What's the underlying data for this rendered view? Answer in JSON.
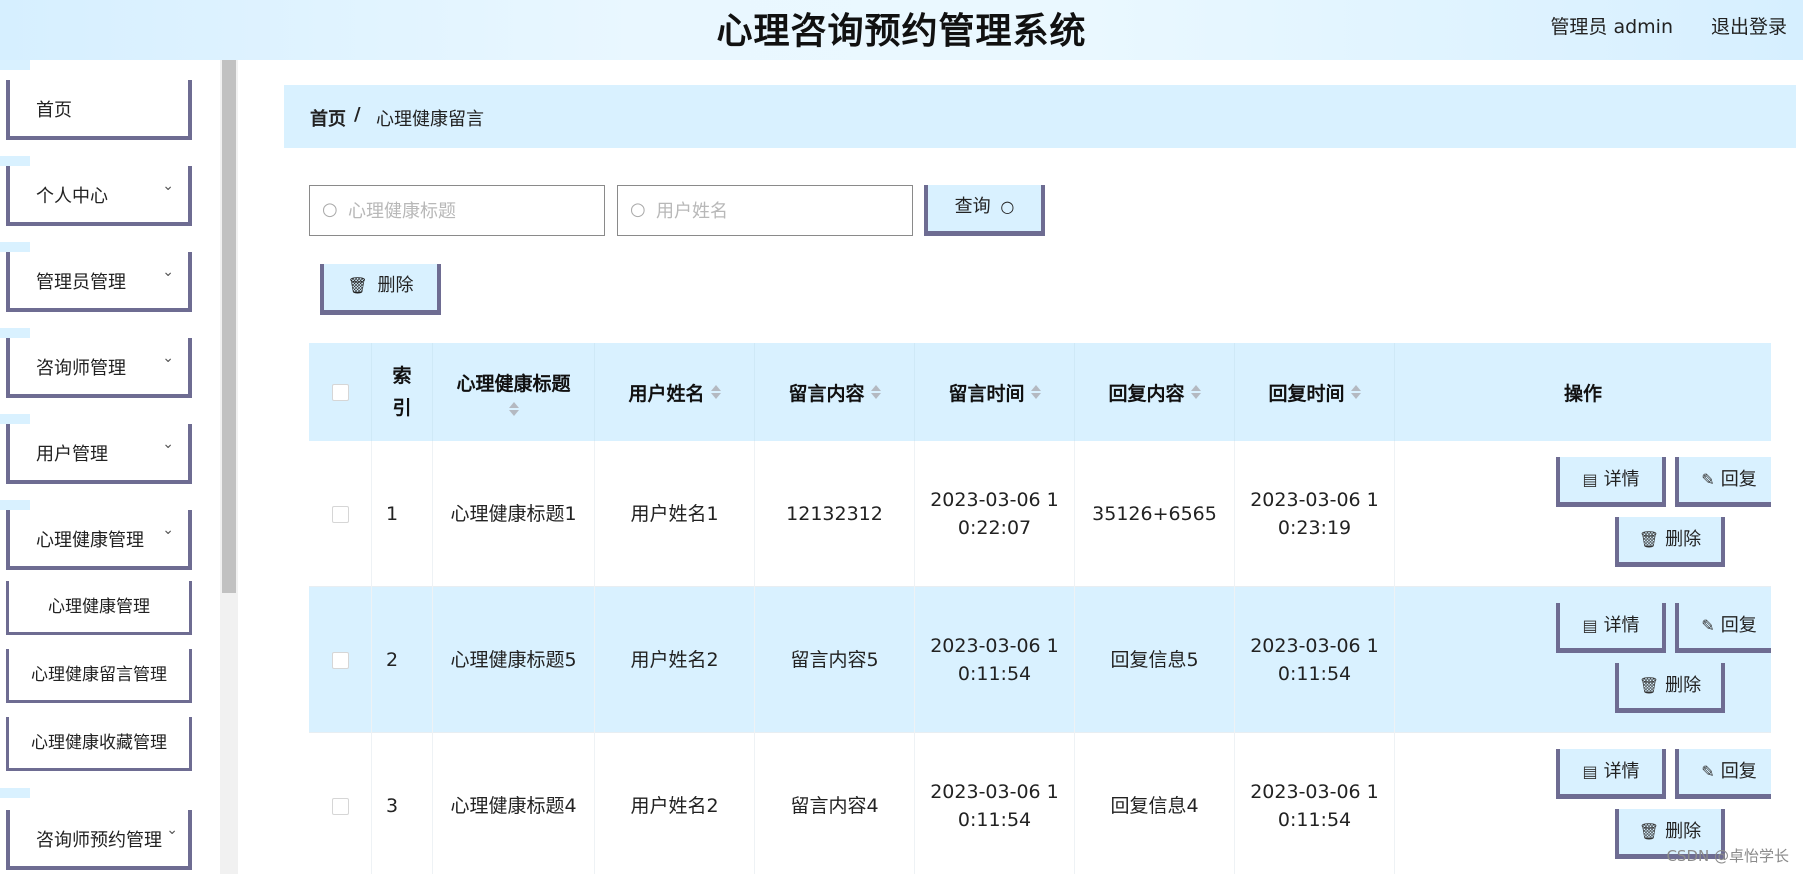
{
  "header": {
    "title": "心理咨询预约管理系统",
    "user": "管理员 admin",
    "logout": "退出登录"
  },
  "sidebar": {
    "items": [
      {
        "label": "首页",
        "chevron": ""
      },
      {
        "label": "个人中心",
        "chevron": "⌄"
      },
      {
        "label": "管理员管理",
        "chevron": "⌄"
      },
      {
        "label": "咨询师管理",
        "chevron": "⌄"
      },
      {
        "label": "用户管理",
        "chevron": "⌄"
      },
      {
        "label": "心理健康管理",
        "chevron": "⌄"
      }
    ],
    "subitems": [
      {
        "label": "心理健康管理"
      },
      {
        "label": "心理健康留言管理"
      },
      {
        "label": "心理健康收藏管理"
      }
    ],
    "last_item": {
      "label": "咨询师预约管理",
      "chevron": "⌄"
    }
  },
  "breadcrumb": {
    "home": "首页",
    "separator": "/",
    "current": "心理健康留言"
  },
  "search": {
    "title_placeholder": "心理健康标题",
    "user_placeholder": "用户姓名",
    "query_label": "查询",
    "query_icon": "search-icon"
  },
  "toolbar": {
    "delete_label": "删除"
  },
  "table": {
    "headers": {
      "index": "索引",
      "title": "心理健康标题",
      "user": "用户姓名",
      "content": "留言内容",
      "time": "留言时间",
      "reply": "回复内容",
      "reply_time": "回复时间",
      "actions": "操作"
    },
    "rows": [
      {
        "index": "1",
        "title": "心理健康标题1",
        "user": "用户姓名1",
        "content": "12132312",
        "time": "2023-03-06 10:22:07",
        "reply": "35126+6565",
        "reply_time": "2023-03-06 10:23:19"
      },
      {
        "index": "2",
        "title": "心理健康标题5",
        "user": "用户姓名2",
        "content": "留言内容5",
        "time": "2023-03-06 10:11:54",
        "reply": "回复信息5",
        "reply_time": "2023-03-06 10:11:54"
      },
      {
        "index": "3",
        "title": "心理健康标题4",
        "user": "用户姓名2",
        "content": "留言内容4",
        "time": "2023-03-06 10:11:54",
        "reply": "回复信息4",
        "reply_time": "2023-03-06 10:11:54"
      }
    ],
    "actions": {
      "detail": "详情",
      "reply": "回复",
      "delete": "删除"
    }
  },
  "watermark": "CSDN @卓怡学长",
  "colors": {
    "accent_bg": "#d9f1ff",
    "border": "#6e6c92"
  }
}
